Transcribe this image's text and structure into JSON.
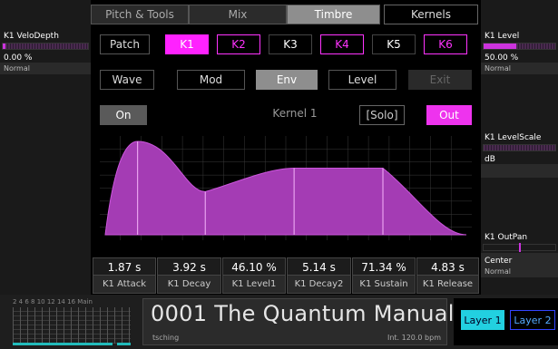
{
  "left_panel": {
    "title": "K1 VeloDepth",
    "value": "0.00 %",
    "sub": "Normal",
    "level": 0.03
  },
  "right_panel": {
    "level": {
      "title": "K1 Level",
      "value": "50.00 %",
      "sub": "Normal",
      "fill": 0.45
    },
    "levelscale": {
      "title": "K1 LevelScale",
      "value": "dB"
    },
    "outpan": {
      "title": "K1 OutPan",
      "value": "Center",
      "sub": "Normal",
      "position": 0.5
    }
  },
  "tabs": [
    "Pitch & Tools",
    "Mix",
    "Timbre",
    "Kernels"
  ],
  "patch_row": {
    "patch": "Patch",
    "kernels": [
      "K1",
      "K2",
      "K3",
      "K4",
      "K5",
      "K6"
    ]
  },
  "nav_row": [
    "Wave",
    "Mod",
    "Env",
    "Level",
    "Exit"
  ],
  "kernel_row": {
    "on": "On",
    "label": "Kernel 1",
    "solo": "[Solo]",
    "out": "Out"
  },
  "envelope": {
    "colors": {
      "fill": "#a43cb4",
      "stroke": "#cc55dd",
      "grid": "#3a3a3a"
    }
  },
  "footer_params": [
    {
      "value": "1.87 s",
      "label": "K1 Attack"
    },
    {
      "value": "3.92 s",
      "label": "K1 Decay"
    },
    {
      "value": "46.10 %",
      "label": "K1 Level1"
    },
    {
      "value": "5.14 s",
      "label": "K1 Decay2"
    },
    {
      "value": "71.34 %",
      "label": "K1 Sustain"
    },
    {
      "value": "4.83 s",
      "label": "K1 Release"
    }
  ],
  "meter": {
    "scale": "2  4  6  8  10  12  14  16",
    "main": "Main"
  },
  "preset": {
    "name": "0001 The Quantum Manual",
    "author": "tsching",
    "tempo": "Int. 120.0 bpm"
  },
  "layers": [
    "Layer 1",
    "Layer 2"
  ],
  "colors": {
    "accent": "#ff22ff",
    "cyan": "#22d0e0"
  }
}
